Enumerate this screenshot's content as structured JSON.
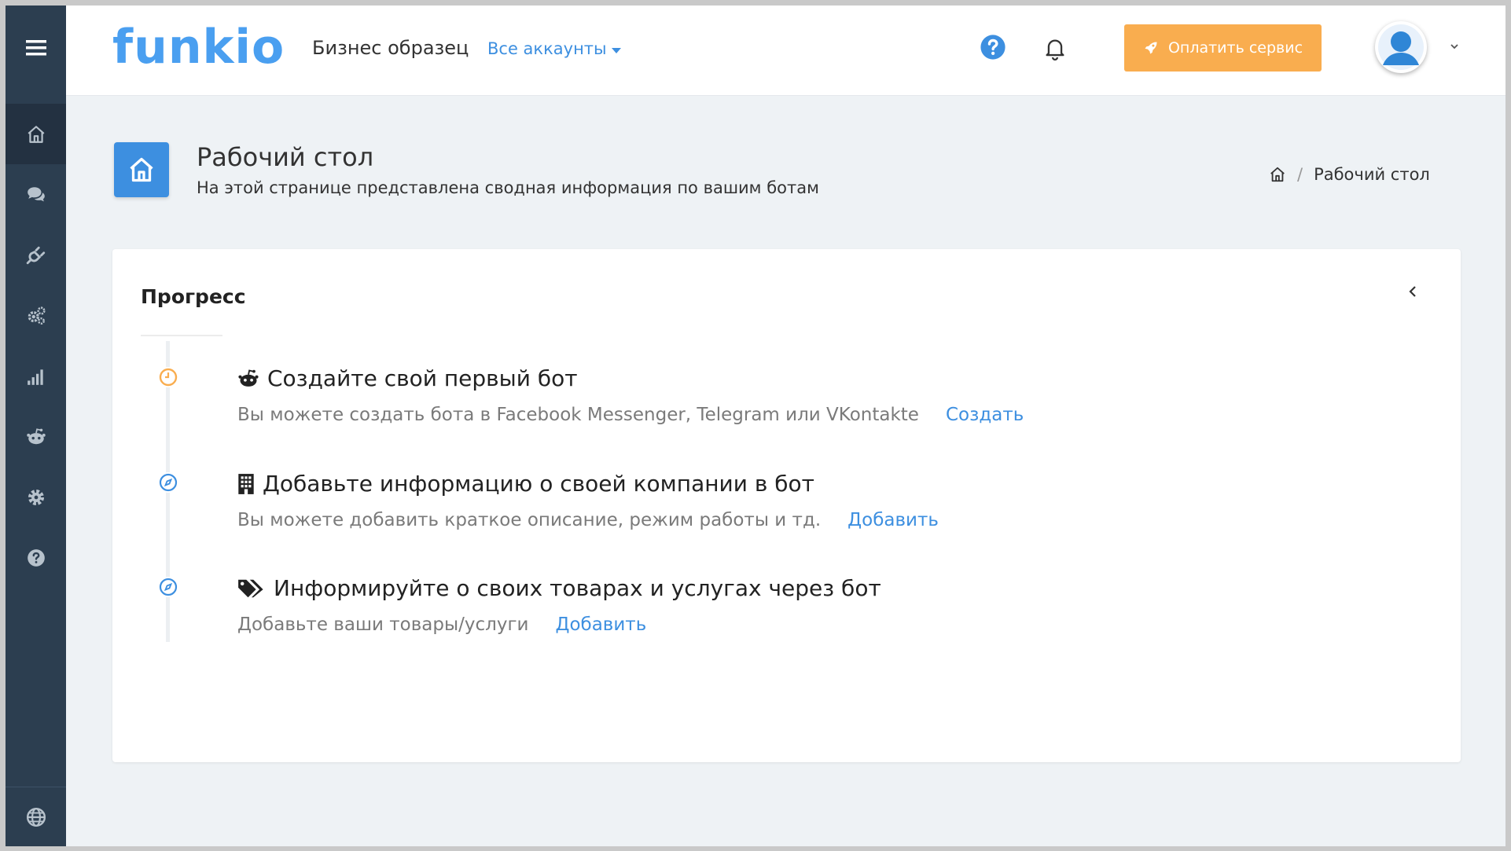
{
  "app": {
    "logo": "funkio",
    "business_name": "Бизнес образец",
    "accounts_dropdown": "Все аккаунты"
  },
  "header": {
    "pay_button": "Оплатить сервис"
  },
  "sidebar": {
    "items": [
      {
        "name": "home",
        "active": true
      },
      {
        "name": "chats"
      },
      {
        "name": "integrations"
      },
      {
        "name": "settings-gears"
      },
      {
        "name": "statistics"
      },
      {
        "name": "bot"
      },
      {
        "name": "settings"
      },
      {
        "name": "help"
      }
    ],
    "bottom": "language"
  },
  "page": {
    "title": "Рабочий стол",
    "subtitle": "На этой странице представлена сводная информация по вашим ботам",
    "breadcrumb": {
      "current": "Рабочий стол"
    }
  },
  "progress": {
    "title": "Прогресс",
    "steps": [
      {
        "icon": "robot-icon",
        "title": "Создайте свой первый бот",
        "desc": "Вы можете создать бота в Facebook Messenger, Telegram или VKontakte",
        "link": "Создать",
        "status": "pending"
      },
      {
        "icon": "building-icon",
        "title": "Добавьте информацию о своей компании в бот",
        "desc": "Вы можете добавить краткое описание, режим работы и тд.",
        "link": "Добавить",
        "status": "todo"
      },
      {
        "icon": "tags-icon",
        "title": "Информируйте о своих товарах и услугах через бот",
        "desc": "Добавьте ваши товары/услуги",
        "link": "Добавить",
        "status": "todo"
      }
    ]
  },
  "colors": {
    "accent": "#3d8fe0",
    "sidebar": "#2c3e50",
    "pay_button": "#f9ad4f",
    "pending": "#f9ad4f"
  }
}
